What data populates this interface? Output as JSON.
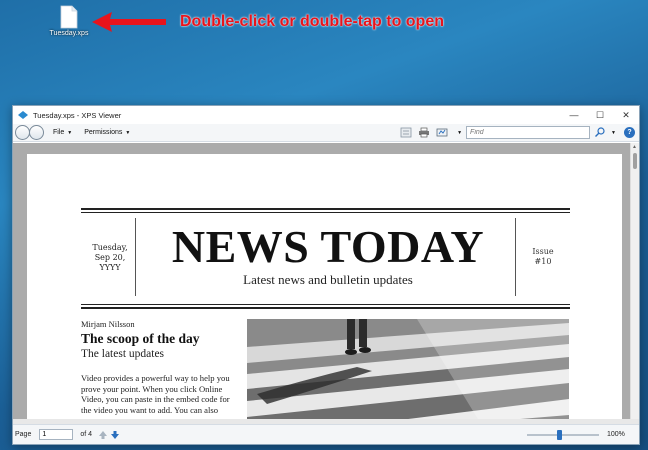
{
  "desktop": {
    "icon_label": "Tuesday.xps",
    "annotation": "Double-click or double-tap to open",
    "annotation_color": "#e8141c"
  },
  "window": {
    "title": "Tuesday.xps - XPS Viewer",
    "controls": {
      "minimize": "—",
      "maximize": "☐",
      "close": "✕"
    }
  },
  "toolbar": {
    "file_label": "File",
    "permissions_label": "Permissions",
    "find_placeholder": "Find",
    "icons": [
      "page-layout-icon",
      "print-icon",
      "signature-icon",
      "search-icon",
      "help-icon"
    ]
  },
  "document": {
    "date_lines": [
      "Tuesday,",
      "Sep 20,",
      "YYYY"
    ],
    "masthead_title": "NEWS TODAY",
    "masthead_subtitle": "Latest news and bulletin updates",
    "issue_lines": [
      "Issue",
      "#10"
    ],
    "author": "Mirjam Nilsson",
    "headline": "The scoop of the day",
    "subheadline": "The latest updates",
    "body_lines": [
      "Video provides a powerful way to help you",
      "prove your point. When you click Online",
      "Video, you can paste in the embed code for",
      "the video you want to add. You can also"
    ]
  },
  "status": {
    "page_label": "Page",
    "page_value": "1",
    "of_label": "of 4",
    "zoom_label": "100%",
    "zoom_fraction": 0.45
  },
  "colors": {
    "accent": "#2a6fbe"
  }
}
